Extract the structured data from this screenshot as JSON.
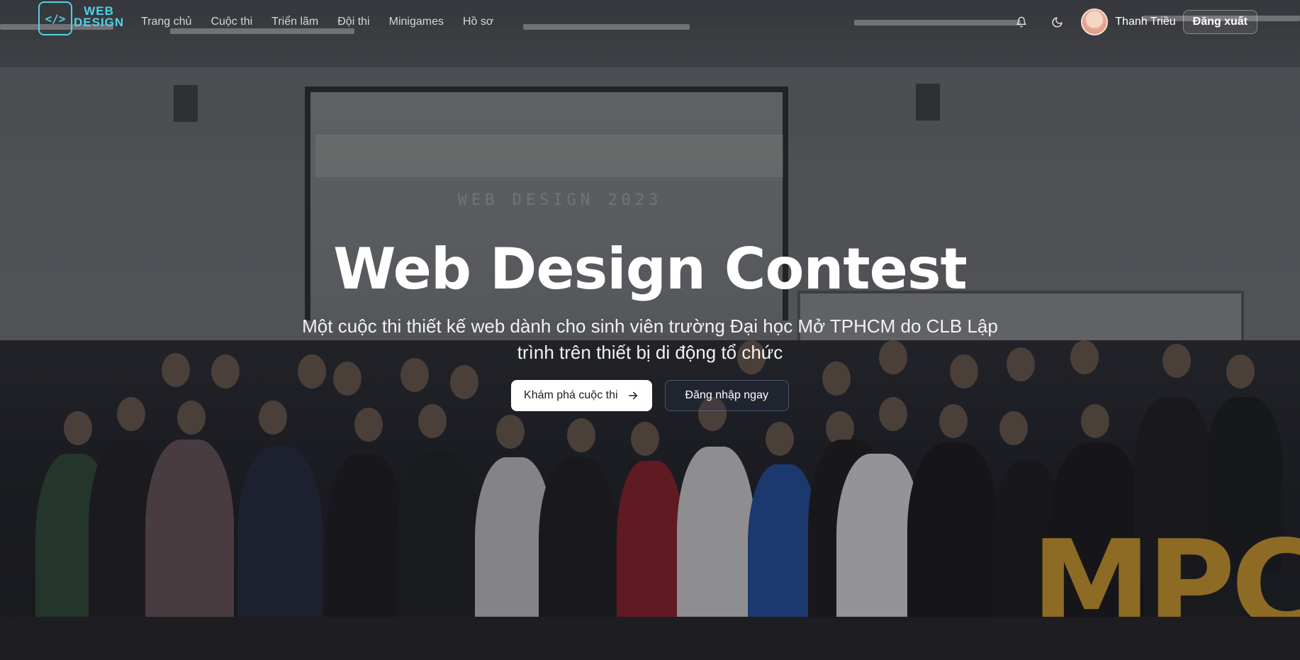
{
  "brand": {
    "logo_word_line1": "WEB",
    "logo_word_line2": "DESIGN",
    "logo_mark": "</>"
  },
  "nav": {
    "items": [
      {
        "label": "Trang chủ"
      },
      {
        "label": "Cuộc thi"
      },
      {
        "label": "Triển lãm"
      },
      {
        "label": "Đội thi"
      },
      {
        "label": "Minigames"
      },
      {
        "label": "Hồ sơ"
      }
    ],
    "notification_icon": "bell-icon",
    "theme_icon": "moon-icon",
    "user_name": "Thanh Triều",
    "logout_label": "Đăng xuất"
  },
  "hero": {
    "title": "Web Design Contest",
    "subtitle": "Một cuộc thi thiết kế web dành cho sinh viên trường Đại học Mở TPHCM do CLB Lập trình trên thiết bị di động tổ chức",
    "primary_cta": "Khám phá cuộc thi",
    "primary_cta_icon": "arrow-right-icon",
    "secondary_cta": "Đăng nhập ngay"
  },
  "background": {
    "screen_text": "WEB DESIGN 2023",
    "letters": "MPC"
  }
}
